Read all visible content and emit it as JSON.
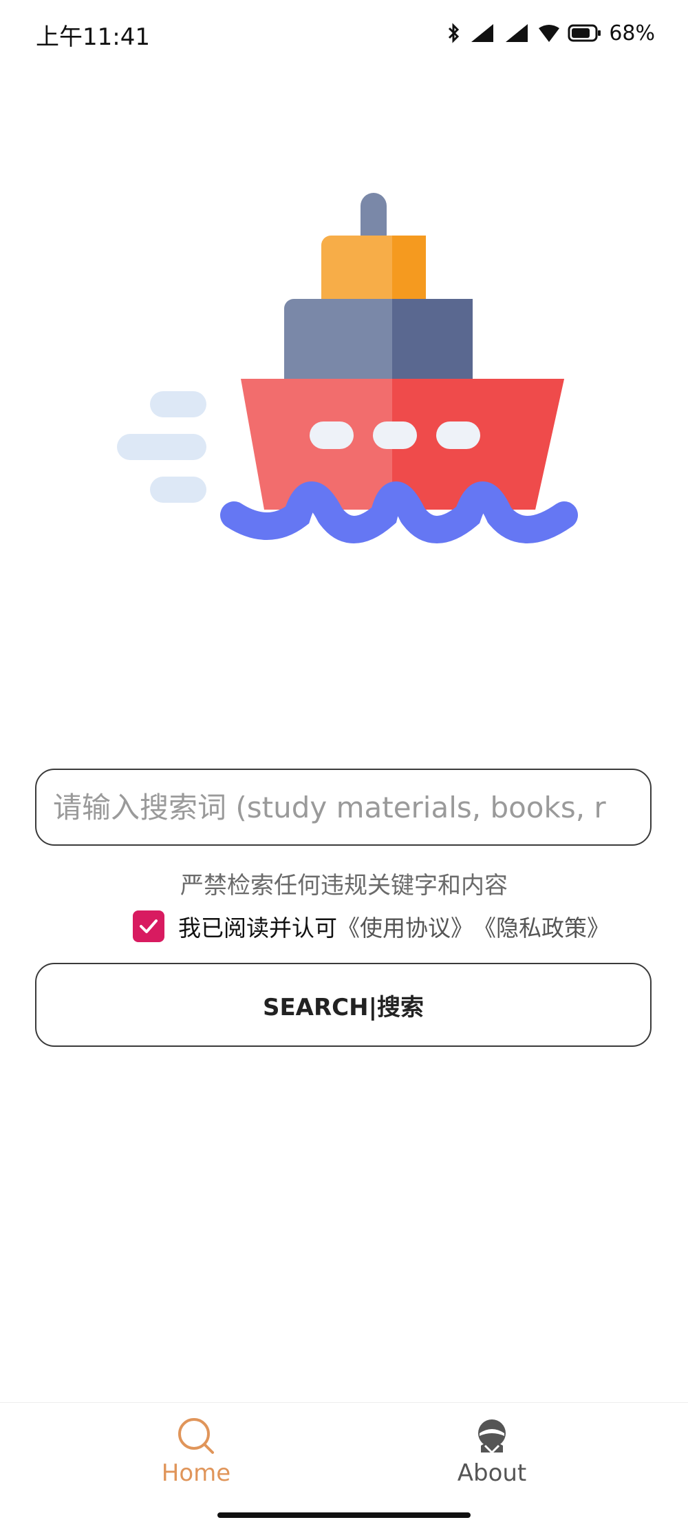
{
  "status_bar": {
    "time": "上午11:41",
    "battery_percent": "68%",
    "icons": [
      "bluetooth-icon",
      "signal-icon",
      "signal-icon",
      "wifi-icon",
      "battery-icon"
    ]
  },
  "hero": {
    "icon": "ship-icon",
    "colors": {
      "hull": "#f06b6b",
      "waves": "#6577f3",
      "cabin": "#7a88a8",
      "top": "#f7ad48",
      "windows": "#eef2f8",
      "speed_lines": "#dde8f6"
    }
  },
  "search": {
    "placeholder": "请输入搜索词 (study materials, books, r",
    "value": ""
  },
  "warning_text": "严禁检索任何违规关键字和内容",
  "agreement": {
    "checked": true,
    "text": "我已阅读并认可",
    "user_agreement_link": "《使用协议》",
    "privacy_policy_link": "《隐私政策》"
  },
  "search_button_label": "SEARCH|搜索",
  "bottom_nav": {
    "items": [
      {
        "label": "Home",
        "icon": "search-icon",
        "active": true
      },
      {
        "label": "About",
        "icon": "captain-icon",
        "active": false
      }
    ],
    "active_color": "#e0955a"
  },
  "colors": {
    "accent": "#d81b60"
  }
}
